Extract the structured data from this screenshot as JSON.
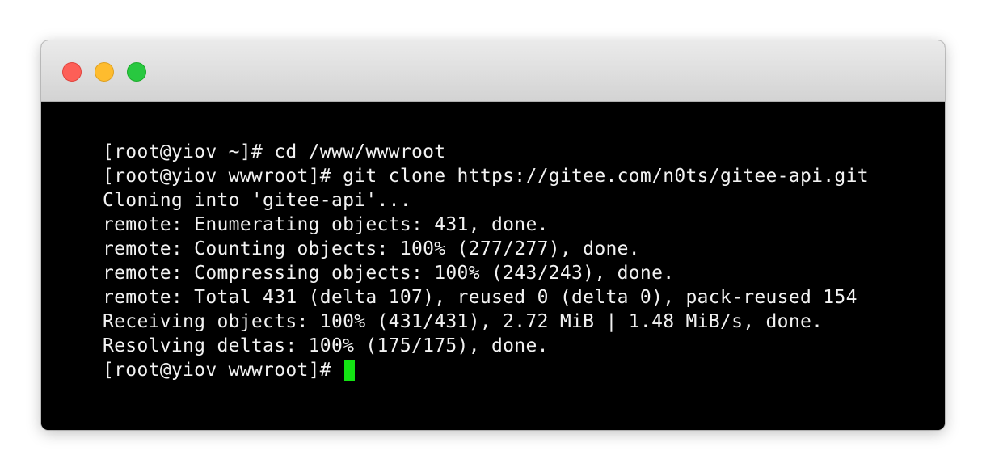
{
  "terminal": {
    "lines": [
      "[root@yiov ~]# cd /www/wwwroot",
      "[root@yiov wwwroot]# git clone https://gitee.com/n0ts/gitee-api.git",
      "Cloning into 'gitee-api'...",
      "remote: Enumerating objects: 431, done.",
      "remote: Counting objects: 100% (277/277), done.",
      "remote: Compressing objects: 100% (243/243), done.",
      "remote: Total 431 (delta 107), reused 0 (delta 0), pack-reused 154",
      "Receiving objects: 100% (431/431), 2.72 MiB | 1.48 MiB/s, done.",
      "Resolving deltas: 100% (175/175), done."
    ],
    "prompt": "[root@yiov wwwroot]# "
  },
  "colors": {
    "background": "#000000",
    "text": "#f2f2f2",
    "cursor": "#13e313",
    "close": "#fd5f57",
    "minimize": "#febc2e",
    "zoom": "#28c840"
  }
}
